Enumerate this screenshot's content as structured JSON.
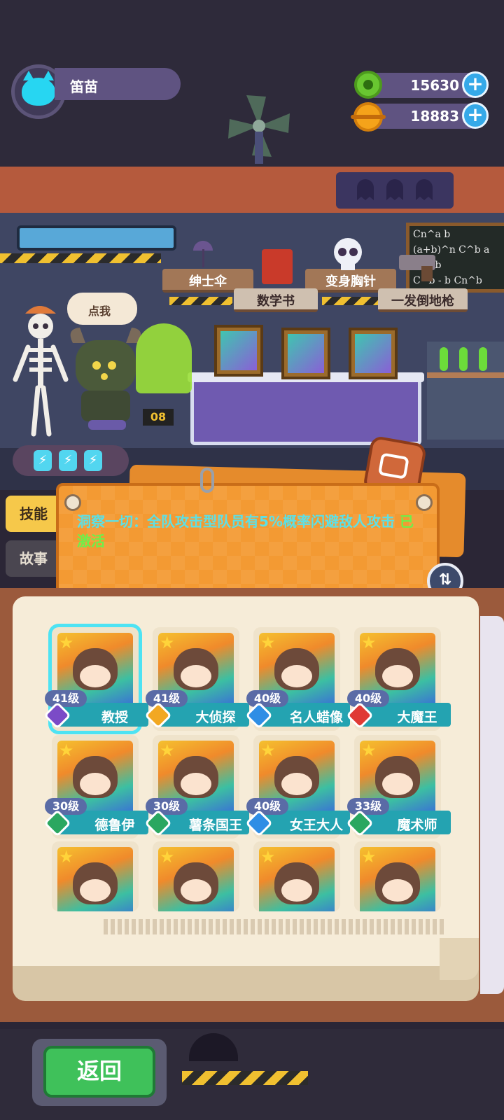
{
  "player": {
    "name": "笛苗"
  },
  "currency": {
    "green": "15630",
    "gold": "18883"
  },
  "scene": {
    "speech": "点我",
    "badge_number": "08",
    "board_lines": [
      "Cn^a b",
      "(a+b)^n  C^b a Cn^b",
      "C^b - b  Cn^b"
    ],
    "shelf_items": [
      "绅士伞",
      "变身胸针",
      "数学书",
      "一发倒地枪"
    ],
    "energy": [
      "⚡",
      "⚡",
      "⚡"
    ]
  },
  "tabs": {
    "skill": "技能",
    "story": "故事"
  },
  "skill": {
    "text": "洞察一切：全队攻击型队员有5%概率闪避敌人攻击",
    "status": "已激活"
  },
  "characters": [
    {
      "level": "41级",
      "name": "教授",
      "badge_color": "#7b4bc7",
      "selected": true
    },
    {
      "level": "41级",
      "name": "大侦探",
      "badge_color": "#f2a822"
    },
    {
      "level": "40级",
      "name": "名人蜡像",
      "badge_color": "#2f8ee5"
    },
    {
      "level": "40级",
      "name": "大魔王",
      "badge_color": "#e03a35"
    },
    {
      "level": "30级",
      "name": "德鲁伊",
      "badge_color": "#2aa760"
    },
    {
      "level": "30级",
      "name": "薯条国王",
      "badge_color": "#2aa760"
    },
    {
      "level": "40级",
      "name": "女王大人",
      "badge_color": "#2f8ee5"
    },
    {
      "level": "33级",
      "name": "魔术师",
      "badge_color": "#2aa760"
    }
  ],
  "buttons": {
    "back": "返回",
    "plus": "+",
    "swap": "⇅"
  },
  "colors": {
    "teal_text": "#5ce0e6",
    "active_green": "#6ef04a",
    "panel_orange": "#f39a33"
  }
}
